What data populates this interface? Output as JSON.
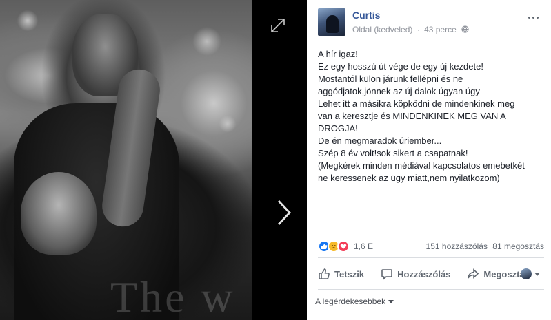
{
  "photo": {
    "overlay_text": "The w"
  },
  "post": {
    "author": "Curtis",
    "page_type": "Oldal (kedveled)",
    "separator": "·",
    "time": "43 perce",
    "text_lines": [
      "A hír igaz!",
      "Ez egy hosszú út vége de egy új kezdete!",
      "Mostantól külön járunk fellépni és ne",
      "aggódjatok,jönnek az új dalok úgyan úgy",
      "Lehet itt a másikra köpködni de mindenkinek meg",
      "van a keresztje és MINDENKINEK MEG VAN A",
      "DROGJA!",
      "De én megmaradok úriember...",
      "Szép 8 év volt!sok sikert a csapatnak!",
      "(Megkérek minden médiával kapcsolatos emebetkét",
      "ne keressenek az ügy miatt,nem nyilatkozom)"
    ]
  },
  "stats": {
    "reactions": "1,6 E",
    "comments": "151 hozzászólás",
    "shares": "81 megosztás"
  },
  "actions": {
    "like": "Tetszik",
    "comment": "Hozzászólás",
    "share": "Megosztás"
  },
  "comments": {
    "sort_label": "A legérdekesebbek"
  },
  "colors": {
    "link": "#365899",
    "like_blue": "#1877f2",
    "sad_yellow": "#f7b928",
    "love_red": "#f33e58"
  }
}
